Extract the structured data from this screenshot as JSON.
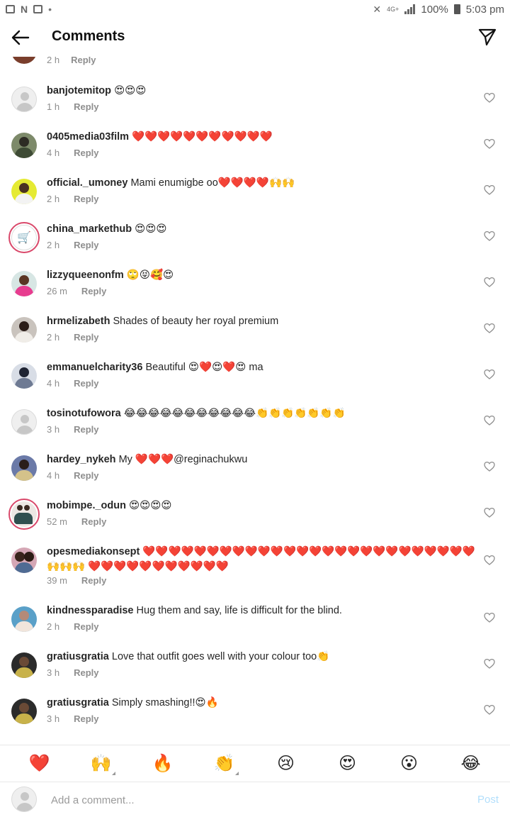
{
  "status_bar": {
    "battery": "100%",
    "time": "5:03 pm",
    "network": "4G+"
  },
  "header": {
    "title": "Comments"
  },
  "partial_comment": {
    "time": "2 h",
    "reply": "Reply"
  },
  "comments": [
    {
      "username": "banjotemitop",
      "text": "😍😍😍",
      "time": "1 h",
      "reply": "Reply"
    },
    {
      "username": "0405media03film",
      "text": "❤️❤️❤️❤️❤️❤️❤️❤️❤️❤️❤️",
      "time": "4 h",
      "reply": "Reply"
    },
    {
      "username": "official._umoney",
      "text": "Mami enumigbe oo❤️❤️❤️❤️🙌🙌",
      "time": "2 h",
      "reply": "Reply"
    },
    {
      "username": "china_markethub",
      "text": "😍😍😍",
      "time": "2 h",
      "reply": "Reply"
    },
    {
      "username": "lizzyqueenonfm",
      "text": "🙄😝🥰😍",
      "time": "26 m",
      "reply": "Reply"
    },
    {
      "username": "hrmelizabeth",
      "text": "Shades of beauty her royal premium",
      "time": "2 h",
      "reply": "Reply"
    },
    {
      "username": "emmanuelcharity36",
      "text": "Beautiful 😍❤️😍❤️😍 ma",
      "time": "4 h",
      "reply": "Reply"
    },
    {
      "username": "tosinotufowora",
      "text": "😂😂😂😂😂😂😂😂😂😂😂👏👏👏👏👏👏👏",
      "time": "3 h",
      "reply": "Reply"
    },
    {
      "username": "hardey_nykeh",
      "text": "My ❤️❤️❤️@reginachukwu",
      "time": "4 h",
      "reply": "Reply"
    },
    {
      "username": "mobimpe._odun",
      "text": "😍😍😍😍",
      "time": "52 m",
      "reply": "Reply"
    },
    {
      "username": "opesmediakonsept",
      "text": "❤️❤️❤️❤️❤️❤️❤️❤️❤️❤️❤️❤️❤️❤️❤️❤️❤️❤️❤️❤️❤️❤️❤️❤️❤️❤️🙌🙌🙌 ❤️❤️❤️❤️❤️❤️❤️❤️❤️❤️❤️",
      "time": "39 m",
      "reply": "Reply"
    },
    {
      "username": "kindnessparadise",
      "text": "Hug them and say, life is difficult for the blind.",
      "time": "2 h",
      "reply": "Reply"
    },
    {
      "username": "gratiusgratia",
      "text": "Love that outfit goes well with your colour too👏",
      "time": "3 h",
      "reply": "Reply"
    },
    {
      "username": "gratiusgratia",
      "text": "Simply smashing!!😍🔥",
      "time": "3 h",
      "reply": "Reply"
    }
  ],
  "emoji_bar": [
    "❤️",
    "🙌",
    "🔥",
    "👏",
    "😢",
    "😍",
    "😮",
    "😂"
  ],
  "composer": {
    "placeholder": "Add a comment...",
    "post_label": "Post"
  },
  "colors": {
    "accent": "#0095f6",
    "post_disabled": "#b2dffc",
    "muted": "#8e8e8e"
  }
}
